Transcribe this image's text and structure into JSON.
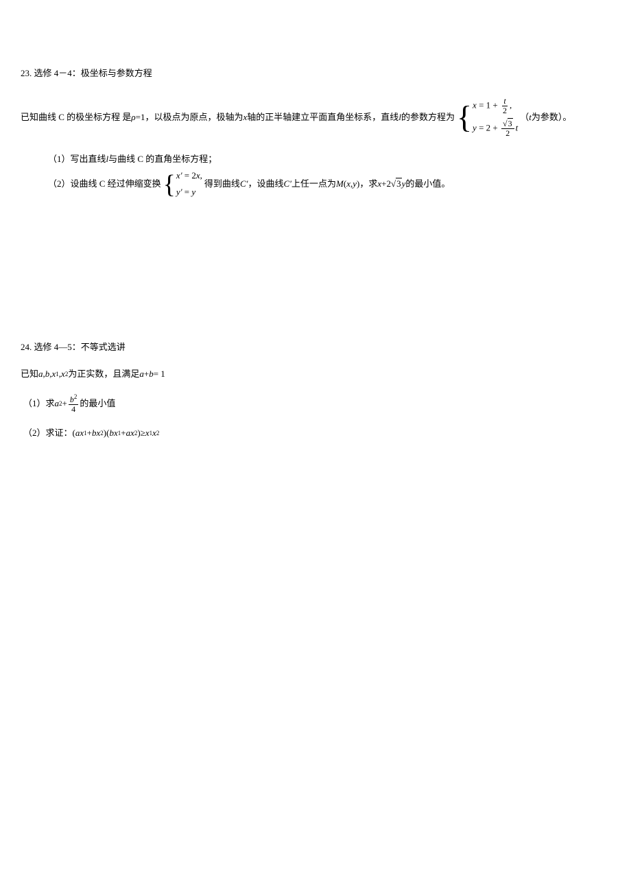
{
  "p23": {
    "title": "23. 选修 4－4：极坐标与参数方程",
    "intro_a": "已知曲线 C 的极坐标方程 是 ",
    "rho": "ρ",
    "eq1": " =1，以极点为原点，极轴为 ",
    "x_axis": "x",
    "intro_b": " 轴的正半轴建立平面直角坐标系，直线 ",
    "l_var": "l",
    "intro_c": " 的参数方程为",
    "sys_x_lhs": "x",
    "sys_x_eq": " = 1 + ",
    "t_var": "t",
    "two": "2",
    "comma": ",",
    "sys_y_lhs": "y",
    "sys_y_eq": " = 2 + ",
    "sqrt3": "3",
    "intro_d": "（",
    "intro_e": " 为参数）。",
    "q1_a": "（1）写出直线 ",
    "q1_b": " 与曲线 C 的直角坐标方程；",
    "q2_a": "（2）设曲线 C 经过伸缩变换",
    "q2_xp": "x′",
    "q2_xeq": " = 2",
    "q2_x": "x",
    "q2_yp": "y′",
    "q2_yeq": " = ",
    "q2_y": "y",
    "q2_b": "得到曲线 ",
    "Cprime": "C′",
    "q2_c": "，设曲线 ",
    "q2_d": " 上任一点为 ",
    "M": "M",
    "q2_e": "(",
    "xy_x": "x",
    "xy_comma": ", ",
    "xy_y": "y",
    "q2_f": ")，求 ",
    "coef2": "2",
    "q2_g": " 的最小值。",
    "plus": " + "
  },
  "p24": {
    "title": "24. 选修 4—5：不等式选讲",
    "intro_a": "已知 ",
    "a": "a",
    "b": "b",
    "x1": "x",
    "sub1": "1",
    "x2": "x",
    "sub2": "2",
    "intro_b": " 为正实数，且满足 ",
    "cond": "a",
    "plus": " + ",
    "cond2": "b",
    "eq1": " = 1",
    "q1_a": "（1）求 ",
    "asq": "a",
    "sq": "2",
    "bsq": "b",
    "four": "4",
    "q1_b": " 的最小值",
    "q2_a": "（2）求证：",
    "lp": "(",
    "rp": ")",
    "ge": " ≥ ",
    "comma": ", "
  }
}
